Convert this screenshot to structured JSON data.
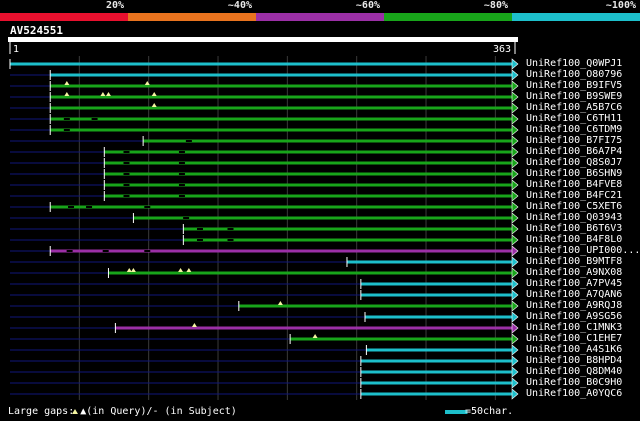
{
  "query": {
    "name": "AV524551",
    "start_label": "1",
    "end_label": "363",
    "length": 363
  },
  "severity_legend": [
    {
      "label": "20%",
      "color": "#e8102e"
    },
    {
      "label": "~40%",
      "color": "#e8731e"
    },
    {
      "label": "~60%",
      "color": "#9b2fa6"
    },
    {
      "label": "~80%",
      "color": "#18a51a"
    },
    {
      "label": "~100%",
      "color": "#1dbfcb"
    }
  ],
  "colors": {
    "unaligned_line": "#10167a",
    "gridline": "#3a3a3a",
    "gap_marker": "#f4f4a0",
    "ruler_bg": "#ffffff"
  },
  "hits": [
    {
      "name": "UniRef100_Q0WPJ1",
      "start": 1,
      "end": 363,
      "identity": "~100%",
      "gaps": []
    },
    {
      "name": "UniRef100_O80796",
      "start": 30,
      "end": 363,
      "identity": "~100%",
      "gaps": []
    },
    {
      "name": "UniRef100_B9IFV5",
      "start": 30,
      "end": 363,
      "identity": "~80%",
      "gaps": [
        {
          "pos": 42,
          "type": "query"
        },
        {
          "pos": 100,
          "type": "query"
        }
      ]
    },
    {
      "name": "UniRef100_B9SWE9",
      "start": 30,
      "end": 363,
      "identity": "~80%",
      "gaps": [
        {
          "pos": 42,
          "type": "query"
        },
        {
          "pos": 68,
          "type": "query"
        },
        {
          "pos": 72,
          "type": "query"
        },
        {
          "pos": 105,
          "type": "query"
        }
      ]
    },
    {
      "name": "UniRef100_A5B7C6",
      "start": 30,
      "end": 363,
      "identity": "~80%",
      "gaps": [
        {
          "pos": 105,
          "type": "query"
        }
      ]
    },
    {
      "name": "UniRef100_C6TH11",
      "start": 30,
      "end": 363,
      "identity": "~80%",
      "gaps": [
        {
          "pos": 42,
          "type": "subject"
        },
        {
          "pos": 62,
          "type": "subject"
        }
      ]
    },
    {
      "name": "UniRef100_C6TDM9",
      "start": 30,
      "end": 363,
      "identity": "~80%",
      "gaps": [
        {
          "pos": 42,
          "type": "subject"
        }
      ]
    },
    {
      "name": "UniRef100_B7FI75",
      "start": 97,
      "end": 363,
      "identity": "~80%",
      "gaps": [
        {
          "pos": 130,
          "type": "subject"
        }
      ]
    },
    {
      "name": "UniRef100_B6A7P4",
      "start": 69,
      "end": 363,
      "identity": "~80%",
      "gaps": [
        {
          "pos": 85,
          "type": "subject"
        },
        {
          "pos": 125,
          "type": "subject"
        }
      ]
    },
    {
      "name": "UniRef100_Q8S0J7",
      "start": 69,
      "end": 363,
      "identity": "~80%",
      "gaps": [
        {
          "pos": 85,
          "type": "subject"
        },
        {
          "pos": 125,
          "type": "subject"
        }
      ]
    },
    {
      "name": "UniRef100_B6SHN9",
      "start": 69,
      "end": 363,
      "identity": "~80%",
      "gaps": [
        {
          "pos": 85,
          "type": "subject"
        },
        {
          "pos": 125,
          "type": "subject"
        }
      ]
    },
    {
      "name": "UniRef100_B4FVE8",
      "start": 69,
      "end": 363,
      "identity": "~80%",
      "gaps": [
        {
          "pos": 85,
          "type": "subject"
        },
        {
          "pos": 125,
          "type": "subject"
        }
      ]
    },
    {
      "name": "UniRef100_B4FC21",
      "start": 69,
      "end": 363,
      "identity": "~80%",
      "gaps": [
        {
          "pos": 85,
          "type": "subject"
        },
        {
          "pos": 125,
          "type": "subject"
        }
      ]
    },
    {
      "name": "UniRef100_C5XET6",
      "start": 30,
      "end": 363,
      "identity": "~80%",
      "gaps": [
        {
          "pos": 45,
          "type": "subject"
        },
        {
          "pos": 58,
          "type": "subject"
        },
        {
          "pos": 100,
          "type": "subject"
        }
      ]
    },
    {
      "name": "UniRef100_Q03943",
      "start": 90,
      "end": 363,
      "identity": "~80%",
      "gaps": [
        {
          "pos": 128,
          "type": "subject"
        }
      ]
    },
    {
      "name": "UniRef100_B6T6V3",
      "start": 126,
      "end": 363,
      "identity": "~80%",
      "gaps": [
        {
          "pos": 138,
          "type": "subject"
        },
        {
          "pos": 160,
          "type": "subject"
        }
      ]
    },
    {
      "name": "UniRef100_B4F8L0",
      "start": 126,
      "end": 363,
      "identity": "~80%",
      "gaps": [
        {
          "pos": 138,
          "type": "subject"
        },
        {
          "pos": 160,
          "type": "subject"
        }
      ]
    },
    {
      "name": "UniRef100_UPI000...",
      "start": 30,
      "end": 363,
      "identity": "~60%",
      "gaps": [
        {
          "pos": 44,
          "type": "subject"
        },
        {
          "pos": 70,
          "type": "subject"
        },
        {
          "pos": 100,
          "type": "subject"
        }
      ]
    },
    {
      "name": "UniRef100_B9MTF8",
      "start": 244,
      "end": 363,
      "identity": "~100%",
      "gaps": []
    },
    {
      "name": "UniRef100_A9NX08",
      "start": 72,
      "end": 363,
      "identity": "~80%",
      "gaps": [
        {
          "pos": 87,
          "type": "query"
        },
        {
          "pos": 90,
          "type": "query"
        },
        {
          "pos": 124,
          "type": "query"
        },
        {
          "pos": 130,
          "type": "query"
        }
      ]
    },
    {
      "name": "UniRef100_A7PV45",
      "start": 254,
      "end": 363,
      "identity": "~100%",
      "gaps": []
    },
    {
      "name": "UniRef100_A7QAN6",
      "start": 254,
      "end": 363,
      "identity": "~100%",
      "gaps": []
    },
    {
      "name": "UniRef100_A9RQJ8",
      "start": 166,
      "end": 363,
      "identity": "~80%",
      "gaps": [
        {
          "pos": 196,
          "type": "query"
        }
      ]
    },
    {
      "name": "UniRef100_A9SG56",
      "start": 257,
      "end": 363,
      "identity": "~100%",
      "gaps": []
    },
    {
      "name": "UniRef100_C1MNK3",
      "start": 77,
      "end": 363,
      "identity": "~60%",
      "gaps": [
        {
          "pos": 134,
          "type": "query"
        }
      ]
    },
    {
      "name": "UniRef100_C1EHE7",
      "start": 203,
      "end": 363,
      "identity": "~80%",
      "gaps": [
        {
          "pos": 221,
          "type": "query"
        }
      ]
    },
    {
      "name": "UniRef100_A4S1K6",
      "start": 258,
      "end": 363,
      "identity": "~100%",
      "gaps": []
    },
    {
      "name": "UniRef100_B8HPD4",
      "start": 254,
      "end": 363,
      "identity": "~100%",
      "gaps": []
    },
    {
      "name": "UniRef100_Q8DM40",
      "start": 254,
      "end": 363,
      "identity": "~100%",
      "gaps": []
    },
    {
      "name": "UniRef100_B0C9H0",
      "start": 254,
      "end": 363,
      "identity": "~100%",
      "gaps": []
    },
    {
      "name": "UniRef100_A0YQC6",
      "start": 254,
      "end": 363,
      "identity": "~100%",
      "gaps": []
    }
  ],
  "footer": {
    "gaps_text": "Large gaps: ▲(in Query)/- (in Subject)",
    "scale_text": "=50char.",
    "scale_chars": 50
  }
}
